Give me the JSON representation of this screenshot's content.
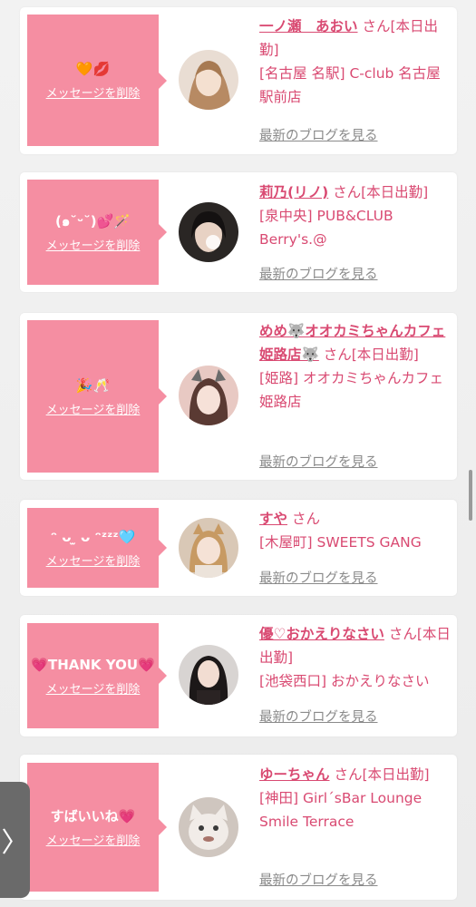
{
  "posts": [
    {
      "message": "🧡💋",
      "delete_label": "メッセージを削除",
      "name": "一ノ瀬　あおい",
      "suffix": " さん[本日出勤]",
      "location": "[名古屋 名駅] C-club 名古屋駅前店",
      "blog_label": "最新のブログを見る"
    },
    {
      "message": "(๑˘ᵕ˘)💕🪄",
      "delete_label": "メッセージを削除",
      "name": "莉乃(リノ)",
      "suffix": " さん[本日出勤]",
      "location": "[泉中央] PUB&CLUB Berry's.@",
      "blog_label": "最新のブログを見る"
    },
    {
      "message": "🎉🥂",
      "delete_label": "メッセージを削除",
      "name": "めめ🐺オオカミちゃんカフェ姫路店🐺",
      "suffix": " さん[本日出勤]",
      "location": "[姫路] オオカミちゃんカフェ姫路店",
      "blog_label": "最新のブログを見る"
    },
    {
      "message": "ᵔ ᴗ ̫ ᴗ ᵔᶻᶻᶻ🩵",
      "delete_label": "メッセージを削除",
      "name": "すや",
      "suffix": " さん",
      "location": "[木屋町] SWEETS GANG",
      "blog_label": "最新のブログを見る"
    },
    {
      "message": "💗THANK YOU💗",
      "delete_label": "メッセージを削除",
      "name": "優♡おかえりなさい",
      "suffix": " さん[本日出勤]",
      "location": "[池袋西口] おかえりなさい",
      "blog_label": "最新のブログを見る"
    },
    {
      "message": "すばいいね💗",
      "delete_label": "メッセージを削除",
      "name": "ゆーちゃん",
      "suffix": " さん[本日出勤]",
      "location": "[神田] Girl´sBar Lounge Smile Terrace",
      "blog_label": "最新のブログを見る"
    }
  ],
  "side_tab": {
    "label": "〉"
  },
  "colors": {
    "accent_pink": "#d94a72",
    "bubble_pink": "#f58ea2",
    "link_gray": "#8a8a8a"
  }
}
